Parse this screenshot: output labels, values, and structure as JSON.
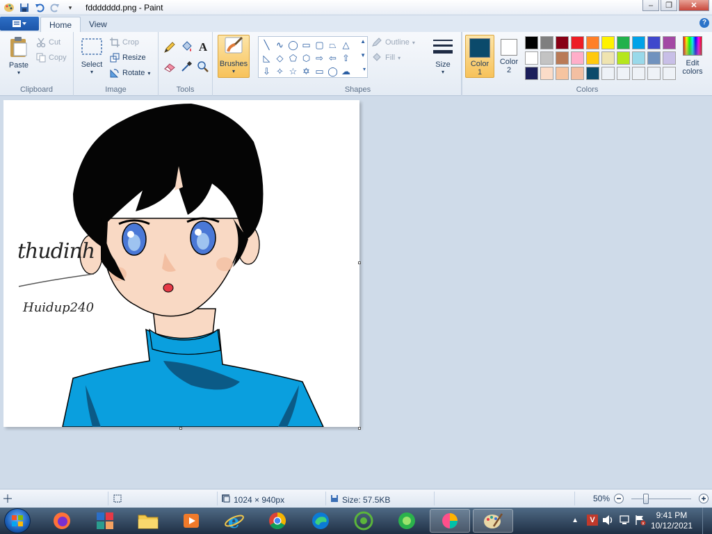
{
  "window": {
    "title": "fddddddd.png - Paint"
  },
  "tabs": [
    {
      "label": "Home"
    },
    {
      "label": "View"
    }
  ],
  "ribbon": {
    "clipboard": {
      "label": "Clipboard",
      "paste": "Paste",
      "cut": "Cut",
      "copy": "Copy"
    },
    "image": {
      "label": "Image",
      "select": "Select",
      "crop": "Crop",
      "resize": "Resize",
      "rotate": "Rotate"
    },
    "tools": {
      "label": "Tools"
    },
    "brushes": {
      "label": "Brushes"
    },
    "shapes": {
      "label": "Shapes",
      "outline": "Outline",
      "fill": "Fill"
    },
    "size": {
      "label": "Size"
    },
    "colors": {
      "label": "Colors",
      "color1_label": "Color",
      "color1_num": "1",
      "color2_label": "Color",
      "color2_num": "2",
      "edit_line1": "Edit",
      "edit_line2": "colors",
      "color1_value": "#0b4a6b",
      "color2_value": "#ffffff",
      "palette": [
        "#000000",
        "#7f7f7f",
        "#880015",
        "#ed1c24",
        "#ff7f27",
        "#fff200",
        "#22b14c",
        "#00a2e8",
        "#3f48cc",
        "#a349a4",
        "#ffffff",
        "#c3c3c3",
        "#b97a57",
        "#ffaec9",
        "#ffc90e",
        "#efe4b0",
        "#b5e61d",
        "#99d9ea",
        "#7092be",
        "#c8bfe7",
        "#1b1e5a",
        "#fbdcc8",
        "#f6c4a0",
        "#f3bfa2",
        "#0b4a6b",
        "#eef2f7",
        "#eef2f7",
        "#eef2f7",
        "#eef2f7",
        "#eef2f7"
      ]
    }
  },
  "canvas": {
    "signature": "thudinh",
    "tag": "Huidup240"
  },
  "statusbar": {
    "dimensions": "1024 × 940px",
    "size": "Size: 57.5KB",
    "zoom": "50%"
  },
  "taskbar": {
    "time": "9:41 PM",
    "date": "10/12/2021"
  }
}
